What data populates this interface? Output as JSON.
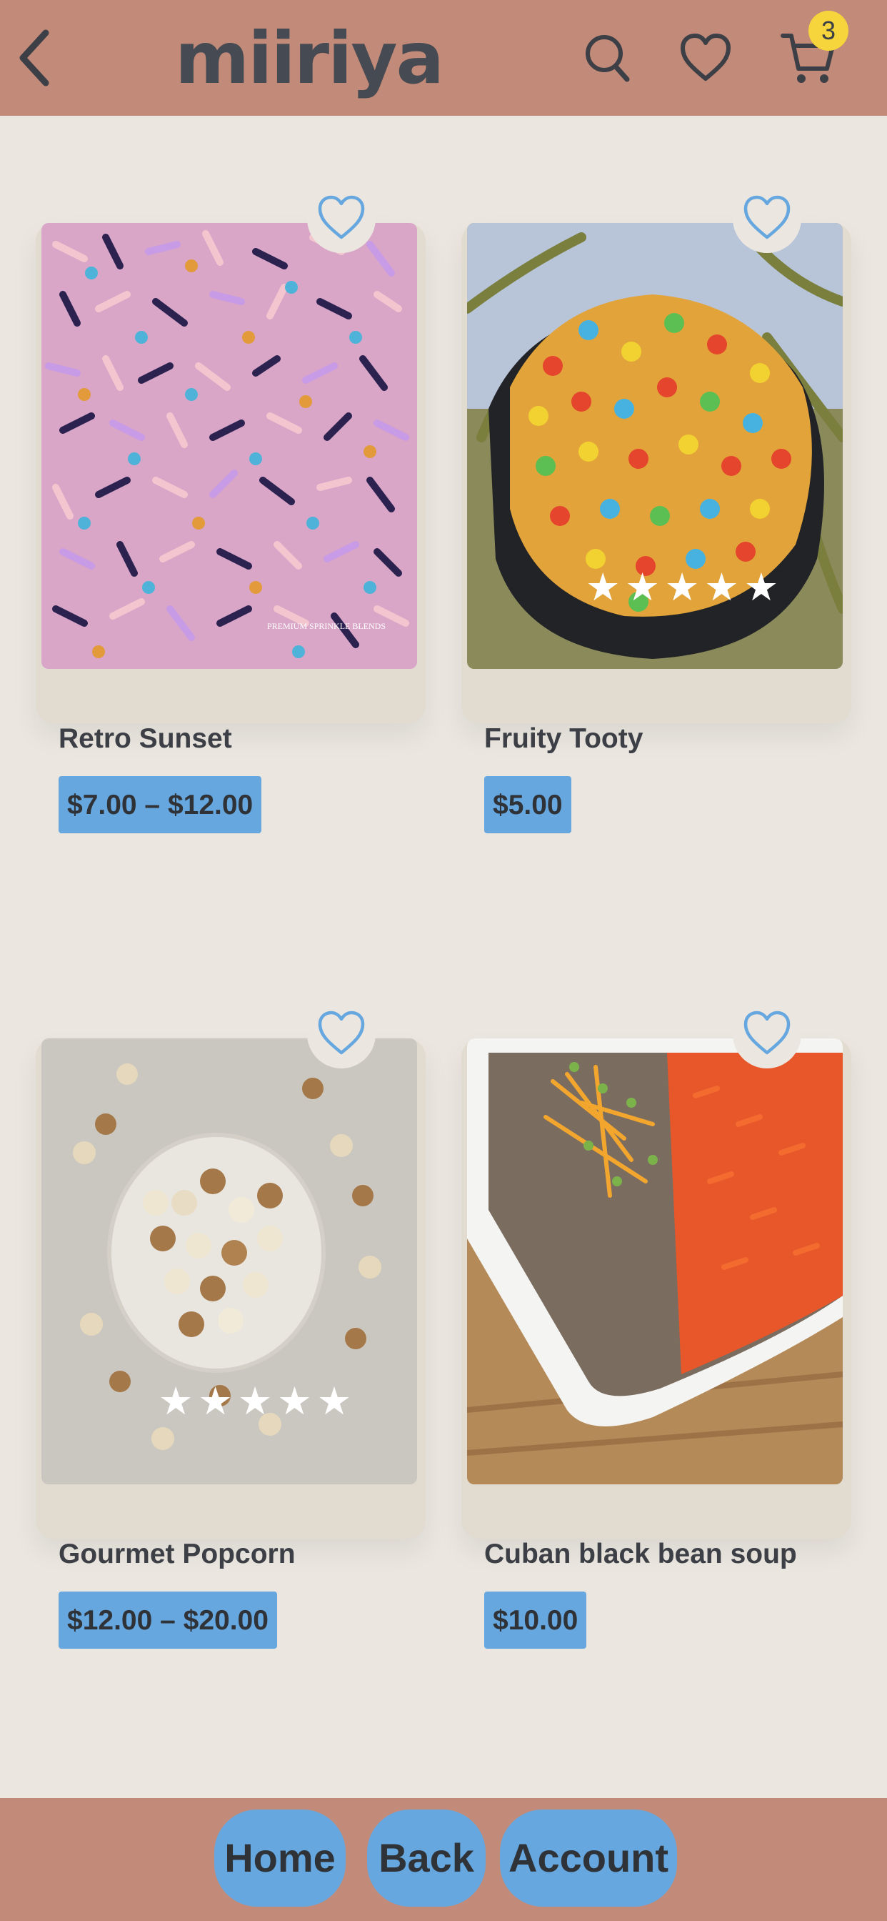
{
  "header": {
    "logo": "miiriya",
    "cart_count": "3",
    "icons": [
      "chevron-left-icon",
      "search-icon",
      "heart-icon",
      "cart-icon"
    ]
  },
  "products": [
    {
      "name": "Retro Sunset",
      "price": "$7.00 – $12.00",
      "rating": 0,
      "image": "sprinkles-photo",
      "image_caption": "PREMIUM SPRINKLE BLENDS"
    },
    {
      "name": "Fruity Tooty",
      "price": "$5.00",
      "rating": 5,
      "image": "cereal-treat-photo"
    },
    {
      "name": "Gourmet Popcorn",
      "price": "$12.00 – $20.00",
      "rating": 5,
      "image": "popcorn-photo"
    },
    {
      "name": "Cuban black bean soup",
      "price": "$10.00",
      "rating": 0,
      "image": "bean-soup-photo"
    }
  ],
  "footer": {
    "home": "Home",
    "back": "Back",
    "account": "Account"
  },
  "colors": {
    "header_bg": "#c28a78",
    "page_bg": "#ebe7e0",
    "card_bg": "#e1dbd0",
    "accent_blue": "#66a7df",
    "badge_yellow": "#f5d53b",
    "text_dark": "#3d3f46"
  }
}
